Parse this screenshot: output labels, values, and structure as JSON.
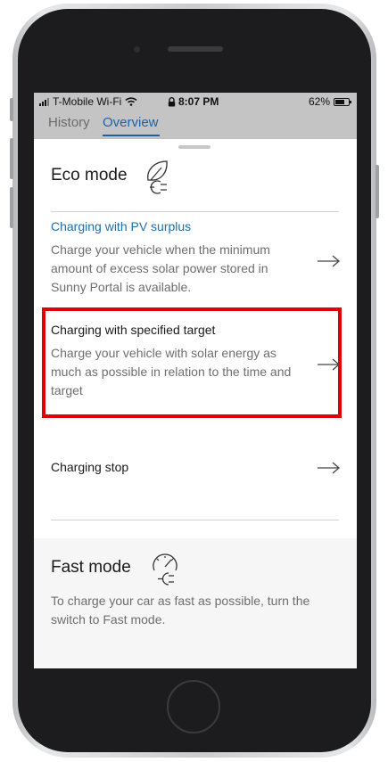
{
  "status_bar": {
    "carrier": "T-Mobile Wi-Fi",
    "time": "8:07 PM",
    "battery": "62%",
    "battery_level": 0.62
  },
  "tabs": [
    {
      "label": "History",
      "active": false
    },
    {
      "label": "Overview",
      "active": true
    }
  ],
  "eco": {
    "title": "Eco mode",
    "icon": "leaf-plug-icon"
  },
  "options": [
    {
      "title": "Charging with PV surplus",
      "description": "Charge your vehicle when the minimum amount of excess solar power stored in Sunny Portal is available."
    },
    {
      "title": "Charging with specified target",
      "description": "Charge your vehicle with solar energy as much as possible in relation to the time and target"
    },
    {
      "title": "Charging stop",
      "description": ""
    }
  ],
  "fast": {
    "title": "Fast mode",
    "icon": "speedometer-plug-icon",
    "description": "To charge your car as fast as possible, turn the switch to Fast mode."
  },
  "colors": {
    "accent": "#1d63a3",
    "link": "#1d6fae",
    "highlight": "#e00000",
    "statusbar": "#c4c4c4"
  }
}
